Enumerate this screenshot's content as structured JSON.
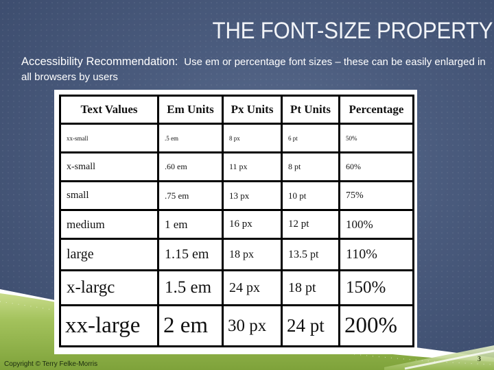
{
  "slide": {
    "title": "THE FONT-SIZE PROPERTY",
    "subtitle_lead": "Accessibility Recommendation:",
    "subtitle_rest": "Use em or percentage font sizes – these can be easily enlarged in all browsers by users",
    "copyright": "Copyright © Terry Felke-Morris",
    "page_number": "3"
  },
  "colors": {
    "background": "#4a5b7d",
    "ground_green": "#8fb14a",
    "title_text": "#f2f4f8"
  },
  "table": {
    "headers": [
      "Text Values",
      "Em Units",
      "Px Units",
      "Pt Units",
      "Percentage"
    ],
    "rows": [
      [
        "xx-small",
        ".5 em",
        "8 px",
        "6 pt",
        "50%"
      ],
      [
        "x-small",
        ".60 em",
        "11 px",
        "8 pt",
        "60%"
      ],
      [
        "small",
        ".75 em",
        "13 px",
        "10 pt",
        "75%"
      ],
      [
        "medium",
        "1 em",
        "16 px",
        "12 pt",
        "100%"
      ],
      [
        "large",
        "1.15 em",
        "18 px",
        "13.5 pt",
        "110%"
      ],
      [
        "x-largc",
        "1.5 em",
        "24 px",
        "18 pt",
        "150%"
      ],
      [
        "xx-large",
        "2 em",
        "30 px",
        "24 pt",
        "200%"
      ]
    ]
  }
}
